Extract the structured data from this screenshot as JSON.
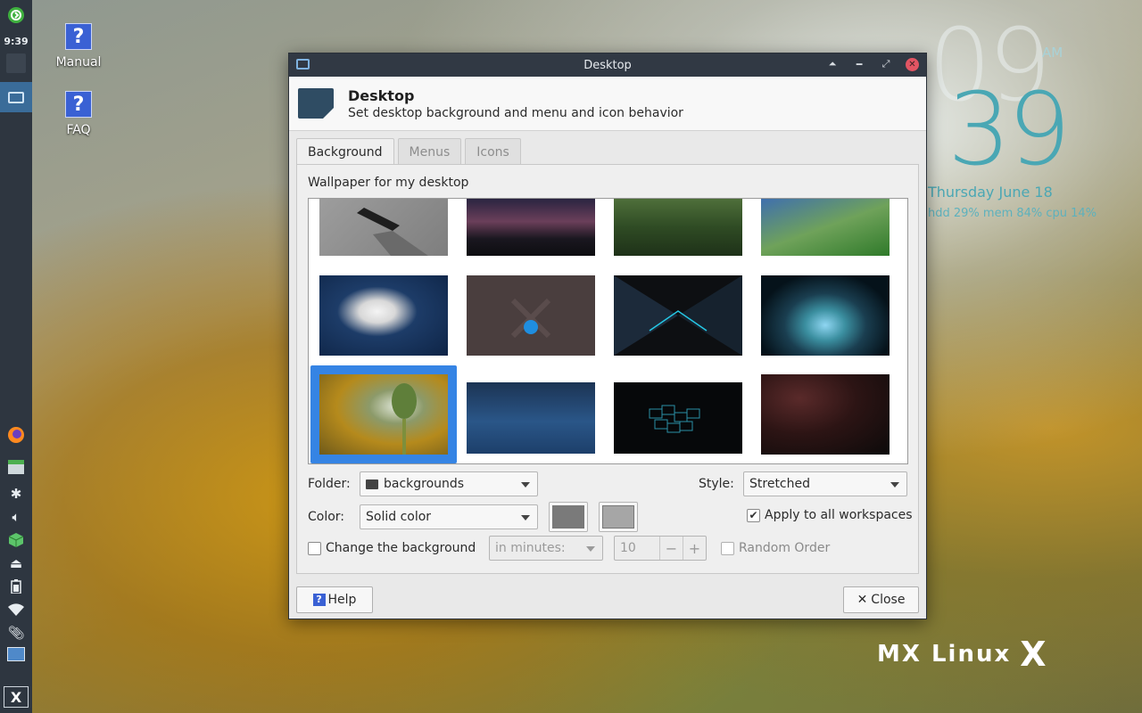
{
  "panel": {
    "clock": "9:39"
  },
  "desktop": {
    "icons": [
      {
        "label": "Manual",
        "glyph": "?"
      },
      {
        "label": "FAQ",
        "glyph": "?"
      }
    ]
  },
  "conky": {
    "hour": "09",
    "minute": "39",
    "ampm": "AM",
    "date": "Thursday   June 18",
    "stats": "hdd 29%  mem 84%  cpu  14%"
  },
  "brand": {
    "logo_text": "MX Linux",
    "logo_mark": "X"
  },
  "window": {
    "title": "Desktop",
    "header_title": "Desktop",
    "header_subtitle": "Set desktop background and menu and icon behavior",
    "tabs": [
      {
        "label": "Background",
        "active": true
      },
      {
        "label": "Menus",
        "active": false
      },
      {
        "label": "Icons",
        "active": false
      }
    ],
    "wallpaper_label": "Wallpaper for my desktop",
    "folder_label": "Folder:",
    "folder_value": "backgrounds",
    "style_label": "Style:",
    "style_value": "Stretched",
    "color_label": "Color:",
    "color_value": "Solid color",
    "color1": "#7a7a7a",
    "color2": "#a6a6a6",
    "apply_all_label": "Apply to all workspaces",
    "apply_all_checked": true,
    "change_bg_label": "Change the background",
    "change_bg_checked": false,
    "interval_unit": "in minutes:",
    "interval_value": "10",
    "random_label": "Random Order",
    "help_label": "Help",
    "close_label": "Close"
  },
  "colors": {
    "accent": "#3584e4",
    "titlebar": "#313944",
    "panel": "#2e3640",
    "conky": "#4aa7b4"
  }
}
